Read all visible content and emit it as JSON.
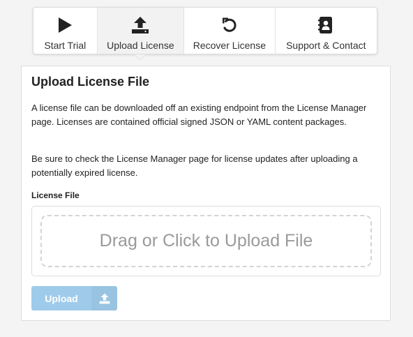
{
  "tabs": [
    {
      "label": "Start Trial",
      "icon": "play-icon"
    },
    {
      "label": "Upload License",
      "icon": "upload-icon"
    },
    {
      "label": "Recover License",
      "icon": "undo-icon"
    },
    {
      "label": "Support & Contact",
      "icon": "contact-book-icon"
    }
  ],
  "active_tab": "Upload License",
  "card": {
    "title": "Upload License File",
    "paragraph1": "A license file can be downloaded off an existing endpoint from the License Manager page. Licenses are contained official signed JSON or YAML content packages.",
    "paragraph2": "Be sure to check the License Manager page for license updates after uploading a potentially expired license.",
    "field_label": "License File",
    "drop_text": "Drag or Click to Upload File",
    "upload_button_label": "Upload"
  },
  "colors": {
    "background": "#f4f4f4",
    "active_tab": "#f2f2f2",
    "button": "#9fcbeb",
    "drop_text": "#9a9a9a"
  }
}
